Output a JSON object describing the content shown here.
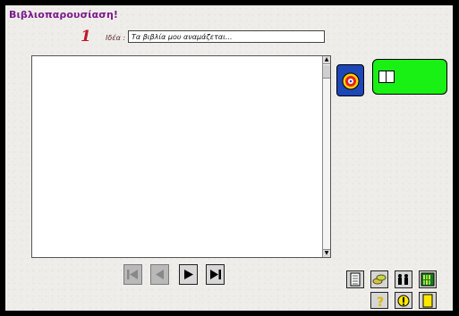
{
  "app": {
    "title": "Βιβλιοπαρουσίαση!"
  },
  "step": {
    "number": "1"
  },
  "idea": {
    "label": "Ιδέα :",
    "value": "Τα βιβλία μου αναμάζεται..."
  },
  "editor": {
    "content": ""
  },
  "colors": {
    "title": "#7a1a8c",
    "number": "#c0162c",
    "book_button": "#19f014",
    "target_button": "#1d46b8"
  },
  "icons": {
    "target": "target-icon",
    "book": "book-icon",
    "first": "first-page-icon",
    "prev": "previous-page-icon",
    "next": "next-page-icon",
    "last": "last-page-icon",
    "notepad": "notepad-icon",
    "money": "coins-icon",
    "people": "people-icon",
    "books": "bookshelf-icon",
    "help": "question-icon",
    "warning": "warning-icon",
    "note": "note-icon"
  }
}
